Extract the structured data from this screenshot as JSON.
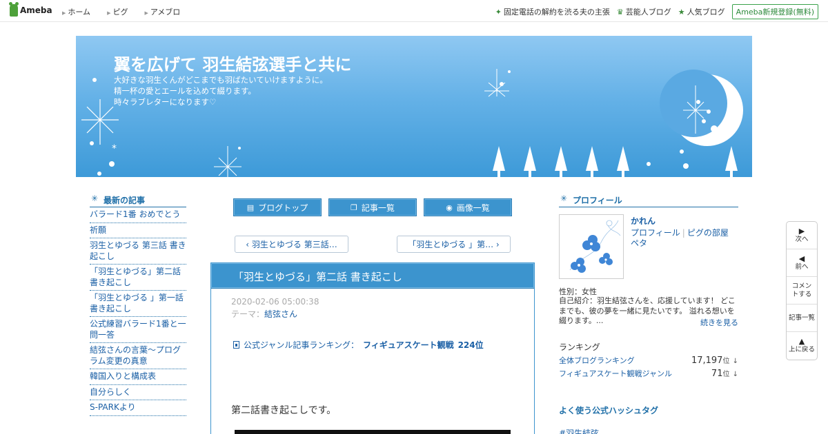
{
  "topbar": {
    "logo_text": "Ameba",
    "nav": [
      "ホーム",
      "ピグ",
      "アメブロ"
    ],
    "right_links": [
      {
        "icon": "sparkle-icon",
        "label": "固定電話の解約を渋る夫の主張"
      },
      {
        "icon": "crown-icon",
        "label": "芸能人ブログ"
      },
      {
        "icon": "star-icon",
        "label": "人気ブログ"
      }
    ],
    "register_label": "Ameba新規登録(無料)"
  },
  "banner": {
    "title": "翼を広げて 羽生結弦選手と共に",
    "description": [
      "大好きな羽生くんがどこまでも羽ばたいていけますように。",
      "精一杯の愛とエールを込めて綴ります。",
      "時々ラブレターになります♡"
    ]
  },
  "left": {
    "heading": "最新の記事",
    "entries": [
      "バラード1番 おめでとう",
      "祈願",
      "羽生とゆづる 第三話 書き起こし",
      "「羽生とゆづる」第二話 書き起こし",
      "「羽生とゆづる 」第一話 書き起こし",
      "公式練習バラード1番と一問一答",
      "結弦さんの言葉〜プログラム変更の真意",
      "韓国入りと構成表",
      "自分らしく",
      "S-PARKより"
    ]
  },
  "center": {
    "nav_buttons": [
      {
        "icon": "document-icon",
        "label": "ブログトップ"
      },
      {
        "icon": "copy-icon",
        "label": "記事一覧"
      },
      {
        "icon": "camera-icon",
        "label": "画像一覧"
      }
    ],
    "prev_label": "羽生とゆづる 第三話…",
    "next_label": "「羽生とゆづる 」第…",
    "article": {
      "title": "「羽生とゆづる」第二話 書き起こし",
      "date": "2020-02-06 05:00:38",
      "theme_label": "テーマ：",
      "theme": "結弦さん",
      "ranking_label": "公式ジャンル記事ランキング：",
      "ranking_genre": "フィギュアスケート観戦",
      "ranking_rank": "224位",
      "body": "第二話書き起こしです。"
    }
  },
  "right": {
    "heading": "プロフィール",
    "name": "かれん",
    "links": [
      "プロフィール",
      "ピグの部屋",
      "ペタ"
    ],
    "gender": "性別：女性",
    "intro": "自己紹介：羽生結弦さんを、応援しています！ どこまでも、彼の夢を一緒に見たいです。 溢れる想いを綴ります。...",
    "more_label": "続きを見る",
    "ranking_heading": "ランキング",
    "rankings": [
      {
        "label": "全体ブログランキング",
        "value": "17,197",
        "unit": "位"
      },
      {
        "label": "フィギュアスケート観戦ジャンル",
        "value": "71",
        "unit": "位"
      }
    ],
    "hashtag_heading": "よく使う公式ハッシュタグ",
    "hashtags": [
      "#羽生結弦"
    ]
  },
  "sidenav": {
    "next": "次へ",
    "prev": "前へ",
    "comment": "コメントする",
    "list": "記事一覧",
    "top": "上に戻る"
  },
  "colors": {
    "accent": "#3c94ce",
    "link": "#1a5fa5",
    "banner_top": "#8fc8f2",
    "banner_bottom": "#3d9ad8",
    "brand_green": "#4ea13a"
  }
}
